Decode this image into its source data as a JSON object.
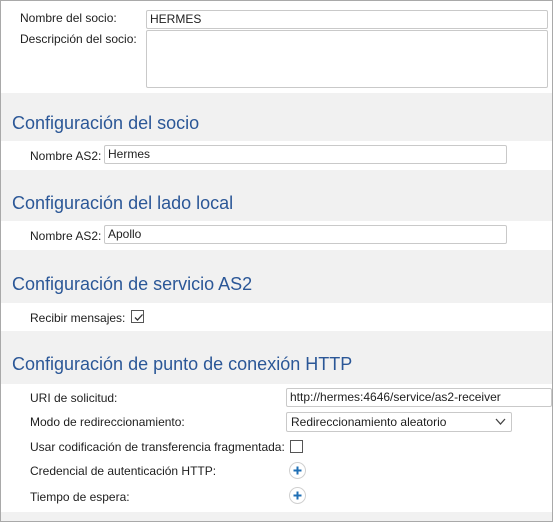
{
  "partner": {
    "name_label": "Nombre del socio:",
    "name_value": "HERMES",
    "description_label": "Descripción del socio:",
    "description_value": ""
  },
  "partner_config": {
    "title": "Configuración del socio",
    "as2_name_label": "Nombre AS2:",
    "as2_name_value": "Hermes"
  },
  "local_config": {
    "title": "Configuración del lado local",
    "as2_name_label": "Nombre AS2:",
    "as2_name_value": "Apollo"
  },
  "as2_service": {
    "title": "Configuración de servicio AS2",
    "receive_label": "Recibir mensajes:",
    "receive_checked": true
  },
  "http_endpoint": {
    "title": "Configuración de punto de conexión HTTP",
    "uri_label": "URI de solicitud:",
    "uri_value": "http://hermes:4646/service/as2-receiver",
    "redirect_label": "Modo de redireccionamiento:",
    "redirect_value": "Redireccionamiento aleatorio",
    "chunked_label": "Usar codificación de transferencia fragmentada:",
    "chunked_checked": false,
    "auth_label": "Credencial de autenticación HTTP:",
    "timeout_label": "Tiempo de espera:"
  },
  "icons": {
    "check": "check-icon",
    "plus": "plus-icon",
    "chevron": "chevron-down-icon"
  },
  "colors": {
    "section_title": "#2b5797",
    "plus": "#1f6fb5",
    "panel": "#ffffff",
    "background": "#f1f1f1"
  }
}
